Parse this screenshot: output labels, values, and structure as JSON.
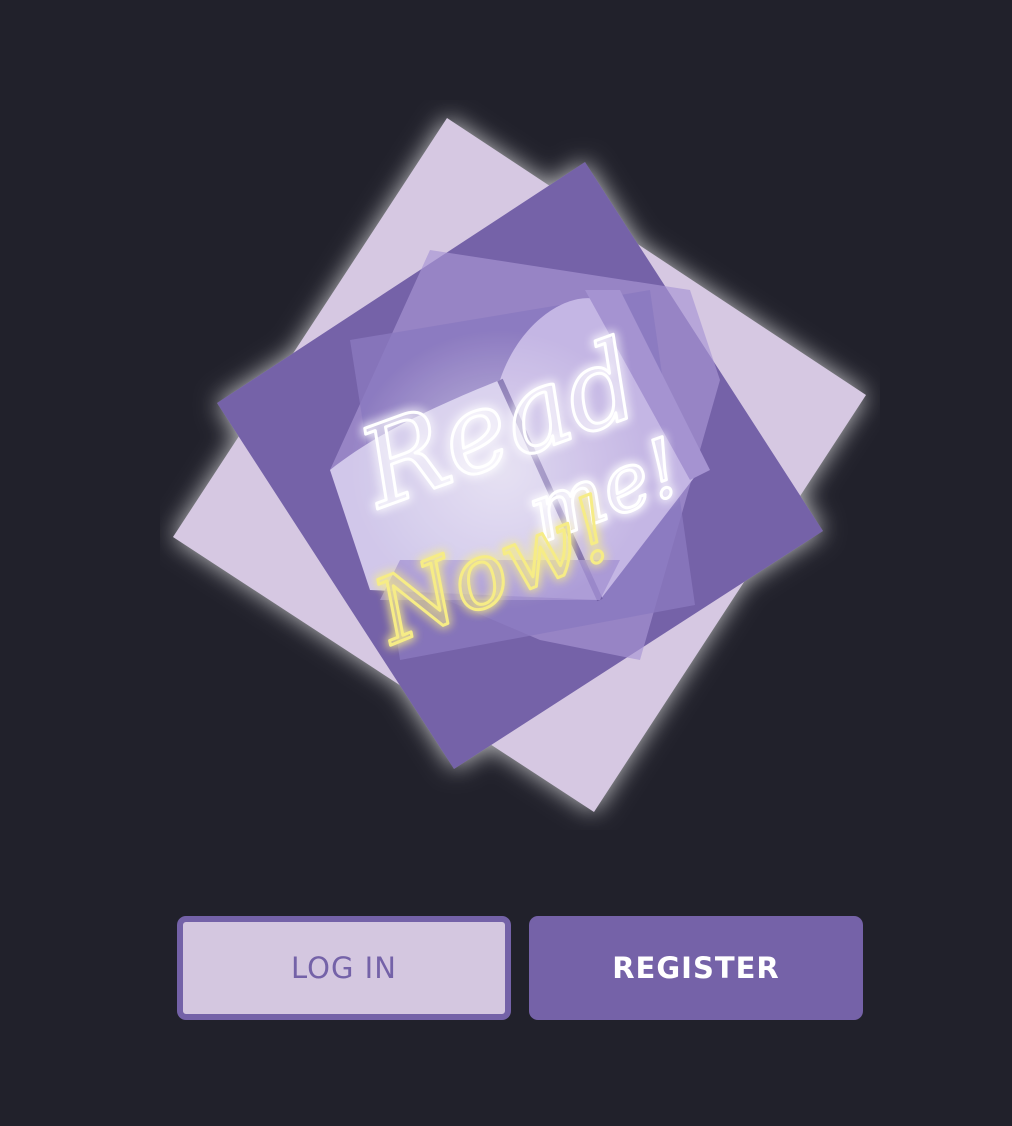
{
  "logo": {
    "line1": "Read",
    "line2": "me!",
    "line3": "Now!",
    "colors": {
      "back_square": "#d6c8e2",
      "front_square": "#7462a8",
      "book": "#ab9ad6",
      "glow_text": "#ffffff",
      "glow_yellow": "#f6ec86"
    },
    "icon": "open-book-icon"
  },
  "actions": {
    "login_label": "LOG IN",
    "register_label": "REGISTER"
  }
}
